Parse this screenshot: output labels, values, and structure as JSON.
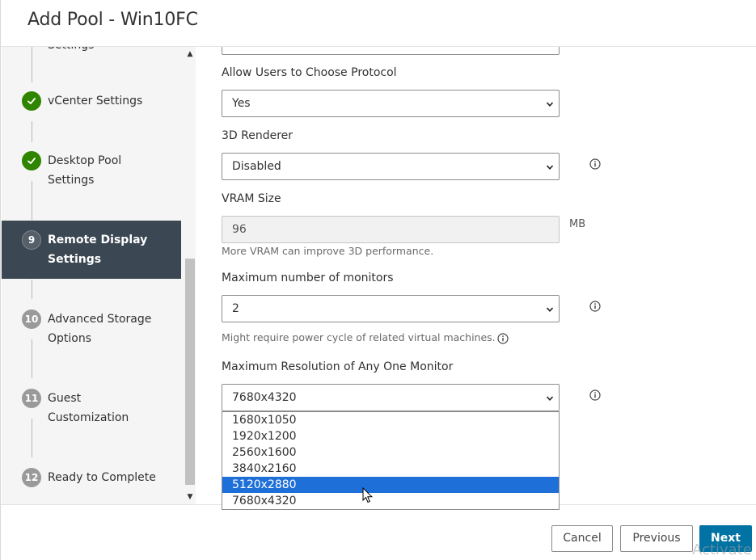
{
  "dialog": {
    "title": "Add Pool - Win10FC"
  },
  "sidebar": {
    "partial_step_label": "Settings",
    "steps": [
      {
        "marker": "",
        "label_line1": "vCenter Settings",
        "label_line2": "",
        "status": "done"
      },
      {
        "marker": "",
        "label_line1": "Desktop Pool",
        "label_line2": "Settings",
        "status": "done"
      },
      {
        "marker": "9",
        "label_line1": "Remote Display",
        "label_line2": "Settings",
        "status": "active"
      },
      {
        "marker": "10",
        "label_line1": "Advanced Storage",
        "label_line2": "Options",
        "status": "pending"
      },
      {
        "marker": "11",
        "label_line1": "Guest",
        "label_line2": "Customization",
        "status": "pending"
      },
      {
        "marker": "12",
        "label_line1": "Ready to Complete",
        "label_line2": "",
        "status": "pending"
      }
    ]
  },
  "form": {
    "allow_protocol": {
      "label": "Allow Users to Choose Protocol",
      "value": "Yes"
    },
    "renderer": {
      "label": "3D Renderer",
      "value": "Disabled"
    },
    "vram": {
      "label": "VRAM Size",
      "value": "96",
      "unit": "MB",
      "helper": "More VRAM can improve 3D performance."
    },
    "monitors": {
      "label": "Maximum number of monitors",
      "value": "2",
      "helper": "Might require power cycle of related virtual machines."
    },
    "resolution": {
      "label": "Maximum Resolution of Any One Monitor",
      "value": "7680x4320",
      "options": [
        "1680x1050",
        "1920x1200",
        "2560x1600",
        "3840x2160",
        "5120x2880",
        "7680x4320"
      ],
      "highlighted": "5120x2880"
    }
  },
  "footer": {
    "cancel_label": "Cancel",
    "previous_label": "Previous",
    "next_label": "Next"
  },
  "watermark": "Activate W",
  "colors": {
    "done_green": "#2f8400",
    "active_step_bg": "#3b4752",
    "primary_button": "#0072a3",
    "option_highlight": "#1e70d8"
  }
}
